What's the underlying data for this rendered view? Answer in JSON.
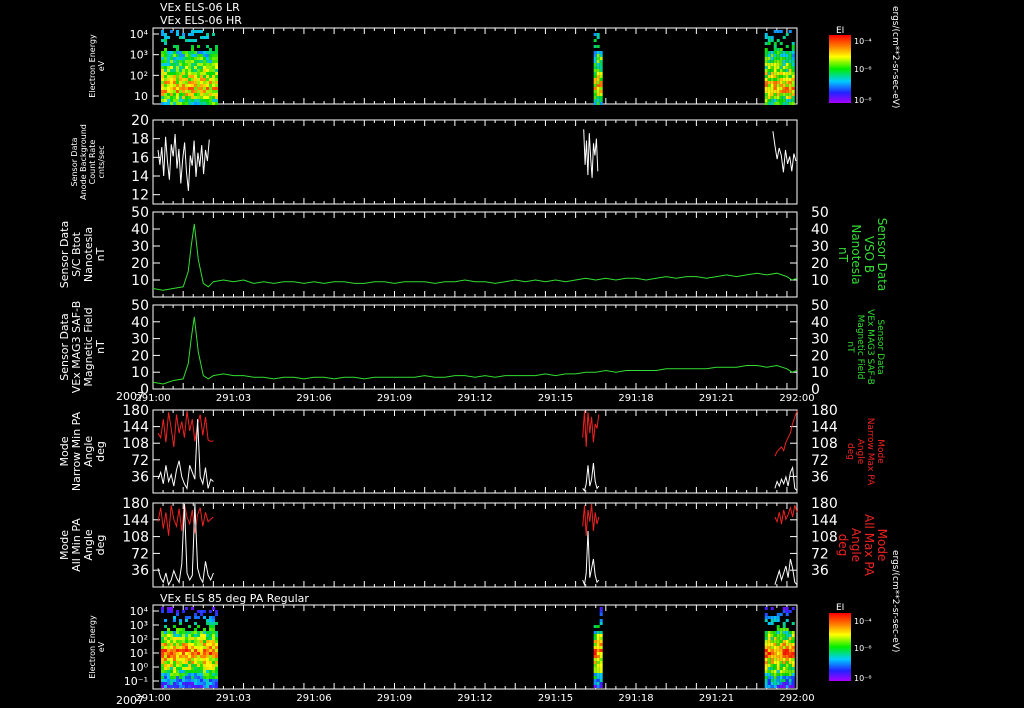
{
  "header": {
    "line1": "VEx ELS-06 LR",
    "line2": "VEx ELS-06 HR"
  },
  "panel7_title": "VEx ELS 85 deg PA Regular",
  "year_label": "2007",
  "x_ticks": [
    "291:00",
    "291:03",
    "291:06",
    "291:09",
    "291:12",
    "291:15",
    "291:18",
    "291:21",
    "292:00"
  ],
  "colorbar": {
    "title": "EI",
    "unit": "ergs/(cm**2-sr-sec-eV)",
    "ticks": [
      "10⁻⁴",
      "10⁻⁶",
      "10⁻⁸"
    ]
  },
  "colors": {
    "white": "#ffffff",
    "green": "#33dd33",
    "red": "#ee2222",
    "background": "#000000"
  },
  "chart_data": [
    {
      "type": "heatmap",
      "id": "p1",
      "ylabel": [
        "Electron Energy",
        "eV"
      ],
      "yticks": [
        "10⁴",
        "10³",
        "10²",
        "10"
      ],
      "ylog": true,
      "coverage_minutes": [
        [
          0,
          6
        ],
        [
          43,
          45
        ],
        [
          60,
          64
        ]
      ]
    },
    {
      "type": "line",
      "id": "p2",
      "ylabel": [
        "Sensor Data",
        "Anode Background",
        "Count Rate",
        "cnts/sec"
      ],
      "ylim": [
        11,
        20
      ],
      "yticks": [
        12,
        14,
        16,
        18,
        20
      ],
      "series": [
        {
          "color": "white",
          "segments": [
            {
              "t0": 0.5,
              "t1": 5.6,
              "values": [
                16.8,
                15.2,
                17.1,
                14.0,
                18.2,
                15.5,
                13.6,
                17.4,
                16.1,
                18.5,
                14.8,
                16.9,
                13.2,
                15.8,
                17.6,
                14.4,
                12.4,
                16.2,
                15.1,
                17.8,
                13.9,
                16.5,
                15.0,
                17.3,
                14.2,
                16.8,
                15.6,
                17.9
              ]
            },
            {
              "t0": 42.8,
              "t1": 44.2,
              "values": [
                19.0,
                15.2,
                17.8,
                14.1,
                18.6,
                15.9,
                13.8,
                17.5,
                16.2,
                18.0,
                14.5
              ]
            },
            {
              "t0": 61.6,
              "t1": 63.9,
              "values": [
                18.8,
                17.2,
                15.8,
                17.0,
                16.2,
                14.4,
                16.8,
                15.3,
                16.1,
                14.5,
                16.4,
                15.6
              ]
            }
          ]
        }
      ]
    },
    {
      "type": "line",
      "id": "p3",
      "ylabel": [
        "Sensor Data",
        "S/C Btot",
        "Nanotesla",
        "nT"
      ],
      "ylabel_right": [
        "Sensor Data",
        "VSO B",
        "Nanotesla",
        "nT"
      ],
      "ylim": [
        0,
        50
      ],
      "yticks": [
        10,
        20,
        30,
        40,
        50
      ],
      "yticks_right": [
        10,
        20,
        30,
        40,
        50
      ],
      "series": [
        {
          "color": "green",
          "x": [
            0,
            1,
            2,
            3,
            3.5,
            3.8,
            4.1,
            4.5,
            5,
            5.5,
            6,
            7,
            8,
            9,
            10,
            11,
            12,
            13,
            14,
            15,
            16,
            17,
            18,
            19,
            20,
            21,
            22,
            23,
            24,
            25,
            26,
            27,
            28,
            29,
            30,
            31,
            32,
            33,
            34,
            35,
            36,
            37,
            38,
            39,
            40,
            41,
            42,
            43,
            44,
            45,
            46,
            47,
            48,
            49,
            50,
            51,
            52,
            53,
            54,
            55,
            56,
            57,
            58,
            59,
            60,
            61,
            62,
            63,
            63.5,
            64
          ],
          "values": [
            5,
            4,
            5,
            6,
            15,
            30,
            43,
            22,
            8,
            6,
            9,
            10,
            9,
            10,
            8,
            9,
            8,
            9,
            9,
            8,
            9,
            8,
            9,
            9,
            8,
            8,
            9,
            9,
            8,
            9,
            9,
            9,
            8,
            9,
            9,
            10,
            9,
            9,
            8,
            9,
            10,
            9,
            10,
            9,
            10,
            9,
            10,
            11,
            10,
            11,
            10,
            11,
            11,
            10,
            11,
            12,
            11,
            12,
            12,
            11,
            12,
            13,
            12,
            13,
            14,
            13,
            14,
            12,
            10,
            11
          ]
        }
      ]
    },
    {
      "type": "line",
      "id": "p4",
      "ylabel": [
        "Sensor Data",
        "VEx MAG3 SAF-B",
        "Magnetic Field",
        "nT"
      ],
      "ylabel_right": [
        "Sensor Data",
        "VEx MAG3 SAF-B",
        "Magnetic Field",
        "nT"
      ],
      "ylim": [
        0,
        50
      ],
      "yticks": [
        0,
        10,
        20,
        30,
        40,
        50
      ],
      "yticks_right": [
        0,
        10,
        20,
        30,
        40,
        50
      ],
      "series": [
        {
          "color": "green",
          "x": [
            0,
            1,
            2,
            3,
            3.5,
            3.8,
            4.1,
            4.5,
            5,
            5.5,
            6,
            7,
            8,
            9,
            10,
            11,
            12,
            13,
            14,
            15,
            16,
            17,
            18,
            19,
            20,
            21,
            22,
            23,
            24,
            25,
            26,
            27,
            28,
            29,
            30,
            31,
            32,
            33,
            34,
            35,
            36,
            37,
            38,
            39,
            40,
            41,
            42,
            43,
            44,
            45,
            46,
            47,
            48,
            49,
            50,
            51,
            52,
            53,
            54,
            55,
            56,
            57,
            58,
            59,
            60,
            61,
            62,
            63,
            63.5,
            64
          ],
          "values": [
            4,
            3,
            5,
            6,
            15,
            30,
            43,
            22,
            8,
            6,
            8,
            9,
            8,
            8,
            7,
            7,
            6,
            7,
            7,
            6,
            7,
            7,
            6,
            7,
            7,
            6,
            7,
            7,
            7,
            7,
            7,
            8,
            7,
            7,
            8,
            8,
            7,
            8,
            7,
            8,
            8,
            8,
            8,
            9,
            8,
            9,
            9,
            10,
            10,
            11,
            10,
            11,
            11,
            11,
            11,
            12,
            12,
            12,
            12,
            12,
            13,
            13,
            13,
            14,
            14,
            13,
            14,
            12,
            10,
            11
          ]
        }
      ]
    },
    {
      "type": "line",
      "id": "p5",
      "ylabel": [
        "Mode",
        "Narrow Min PA",
        "Angle",
        "deg"
      ],
      "ylabel_right": [
        "Mode",
        "Narrow Max PA",
        "Angle",
        "deg"
      ],
      "ylim": [
        0,
        180
      ],
      "yticks": [
        36,
        72,
        108,
        144,
        180
      ],
      "yticks_right": [
        36,
        72,
        108,
        144,
        180
      ],
      "series": [
        {
          "color": "red",
          "segments": [
            {
              "t0": 0.5,
              "t1": 6.0,
              "values": [
                130,
                120,
                160,
                110,
                175,
                140,
                100,
                170,
                130,
                155,
                120,
                178,
                135,
                160,
                112,
                150,
                170,
                125,
                165,
                115,
                112,
                113
              ]
            },
            {
              "t0": 42.7,
              "t1": 44.3,
              "values": [
                120,
                178,
                100,
                175,
                130,
                165,
                110,
                150,
                140,
                170
              ]
            },
            {
              "t0": 61.8,
              "t1": 64.0,
              "values": [
                80,
                90,
                95,
                100,
                92,
                110,
                120,
                130,
                150,
                165,
                178
              ]
            }
          ]
        },
        {
          "color": "white",
          "segments": [
            {
              "t0": 0.5,
              "t1": 6.0,
              "values": [
                30,
                45,
                20,
                60,
                25,
                40,
                15,
                50,
                70,
                35,
                20,
                10,
                60,
                45,
                30,
                160,
                35,
                20,
                55,
                10,
                30,
                25
              ]
            },
            {
              "t0": 42.7,
              "t1": 44.3,
              "values": [
                10,
                5,
                20,
                60,
                15,
                30,
                65,
                25,
                10,
                15
              ]
            },
            {
              "t0": 61.8,
              "t1": 64.0,
              "values": [
                10,
                25,
                15,
                30,
                20,
                35,
                15,
                45,
                55,
                10,
                5
              ]
            }
          ]
        }
      ]
    },
    {
      "type": "line",
      "id": "p6",
      "ylabel": [
        "Mode",
        "All Min PA",
        "Angle",
        "deg"
      ],
      "ylabel_right": [
        "Mode",
        "All Max PA",
        "Angle",
        "deg"
      ],
      "ylim": [
        0,
        180
      ],
      "yticks": [
        36,
        72,
        108,
        144,
        180
      ],
      "yticks_right": [
        36,
        72,
        108,
        144,
        180
      ],
      "series": [
        {
          "color": "red",
          "segments": [
            {
              "t0": 0.5,
              "t1": 6.0,
              "values": [
                140,
                170,
                125,
                160,
                110,
                175,
                145,
                130,
                168,
                120,
                178,
                150,
                135,
                165,
                115,
                155,
                170,
                130,
                160,
                140,
                145,
                150
              ]
            },
            {
              "t0": 42.7,
              "t1": 44.3,
              "values": [
                130,
                175,
                110,
                165,
                140,
                178,
                120,
                160,
                135,
                150
              ]
            },
            {
              "t0": 61.8,
              "t1": 64.0,
              "values": [
                150,
                140,
                160,
                135,
                165,
                145,
                155,
                170,
                150,
                175,
                160
              ]
            }
          ]
        },
        {
          "color": "white",
          "segments": [
            {
              "t0": 0.5,
              "t1": 6.0,
              "values": [
                40,
                20,
                10,
                30,
                5,
                15,
                35,
                20,
                10,
                50,
                178,
                30,
                15,
                25,
                178,
                40,
                20,
                10,
                55,
                25,
                15,
                30
              ]
            },
            {
              "t0": 42.7,
              "t1": 44.3,
              "values": [
                15,
                5,
                30,
                120,
                20,
                40,
                60,
                25,
                10,
                15
              ]
            },
            {
              "t0": 61.8,
              "t1": 64.0,
              "values": [
                5,
                20,
                35,
                15,
                30,
                45,
                20,
                60,
                40,
                10,
                5
              ]
            }
          ]
        }
      ]
    },
    {
      "type": "heatmap",
      "id": "p7",
      "ylabel": [
        "Electron Energy",
        "eV"
      ],
      "yticks": [
        "10⁴",
        "10³",
        "10²",
        "10¹",
        "10⁰",
        "10⁻¹"
      ],
      "ylog": true,
      "coverage_minutes": [
        [
          0,
          6
        ],
        [
          43,
          45
        ],
        [
          60,
          64
        ]
      ]
    }
  ]
}
